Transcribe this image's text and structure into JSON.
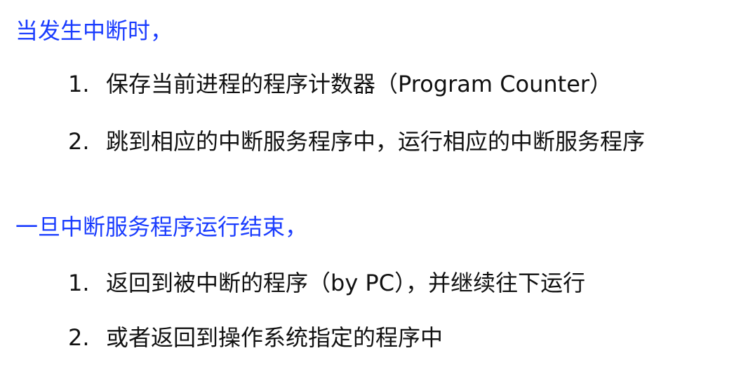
{
  "sections": [
    {
      "heading": "当发生中断时，",
      "items": [
        {
          "number": "1.",
          "text": "保存当前进程的程序计数器（Program Counter）"
        },
        {
          "number": "2.",
          "text": "跳到相应的中断服务程序中，运行相应的中断服务程序"
        }
      ]
    },
    {
      "heading": "一旦中断服务程序运行结束，",
      "items": [
        {
          "number": "1.",
          "text": "返回到被中断的程序（by PC），并继续往下运行"
        },
        {
          "number": "2.",
          "text": "或者返回到操作系统指定的程序中"
        }
      ]
    }
  ],
  "colors": {
    "heading": "#1a3cff",
    "body_text": "#111111",
    "background": "#ffffff"
  }
}
